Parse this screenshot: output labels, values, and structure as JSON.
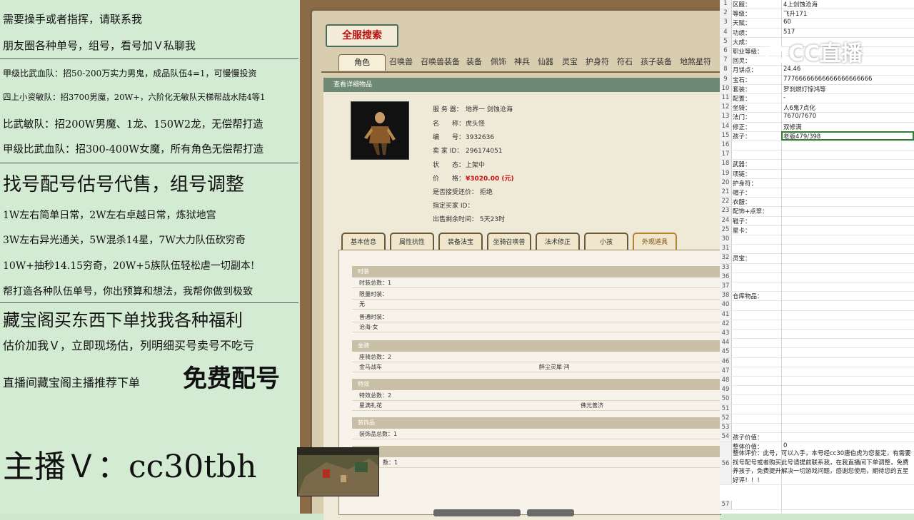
{
  "left_panel": {
    "lines": [
      "需要操手或者指挥，请联系我",
      "朋友圈各种单号，组号，看号加Ｖ私聊我",
      "甲级比武血队：招50-200万实力男鬼，成品队伍4=1，可慢慢投资",
      "四上小资敏队：招3700男魔，20W+，六阶化无敏队天梯帮战水陆4等1",
      "比武敏队：招200W男魔、1龙、150W2龙，无偿帮打造",
      "甲级比武血队：招300-400W女魔，所有角色无偿帮打造",
      "找号配号估号代售，组号调整",
      "1W左右简单日常，2W左右卓越日常，炼狱地宫",
      "3W左右异光通关，5W混杀14星，7W大力队伍砍穷奇",
      "10W+抽秒14.15穷奇，20W+5族队伍轻松虐一切副本!",
      "帮打造各种队伍单号，你出预算和想法，我帮你做到极致",
      "藏宝阁买东西下单找我各种福利",
      "估价加我Ｖ，立即现场估，列明细买号卖号不吃亏",
      "直播间藏宝阁主播推荐下单",
      "免费配号",
      "主播Ｖ：cc30tbh"
    ]
  },
  "game": {
    "banner": "全服搜索",
    "tabs": [
      "角色",
      "召唤兽",
      "召唤兽装备",
      "装备",
      "佩饰",
      "神兵",
      "仙器",
      "灵宝",
      "护身符",
      "符石",
      "孩子装备",
      "地煞星符"
    ],
    "section_title": "查看详细物品",
    "info": [
      {
        "label": "服 务 器：",
        "value": "地界一 剑蚀沧海"
      },
      {
        "label": "名　　称：",
        "value": "虎头怪"
      },
      {
        "label": "编　　号：",
        "value": "3932636"
      },
      {
        "label": "卖 家 ID：",
        "value": "296174051"
      },
      {
        "label": "状　　态：",
        "value": "上架中"
      },
      {
        "label": "价　　格：",
        "value": "¥3020.00 (元)"
      },
      {
        "label": "是否接受还价：",
        "value": "拒绝"
      },
      {
        "label": "指定买家 ID：",
        "value": ""
      },
      {
        "label": "出售剩余时间：",
        "value": "5天23时"
      }
    ],
    "subtabs": [
      "基本信息",
      "属性抗性",
      "装备法宝",
      "坐骑召唤兽",
      "法术修正",
      "小孩",
      "外观道具"
    ],
    "sections": [
      {
        "title": "时装",
        "rows": [
          "时装总数：1",
          "限量时装：",
          "无",
          "普通时装：",
          "沧海·女"
        ]
      },
      {
        "title": "坐骑",
        "rows": [
          "座骑总数：2",
          "金马战车"
        ],
        "extra": "醉尘灵犀·鸿"
      },
      {
        "title": "特效",
        "rows": [
          "特效总数：2",
          "星满礼花"
        ],
        "extra": "佛光普济"
      },
      {
        "title": "装饰品",
        "rows": [
          "装饰品总数：1"
        ]
      },
      {
        "title": "",
        "rows": [
          "数：1"
        ]
      }
    ]
  },
  "sheet": {
    "logo": "CC直播",
    "rows": [
      {
        "n": "1",
        "k": "区服：",
        "v": "4上剑蚀沧海"
      },
      {
        "n": "2",
        "k": "等级：",
        "v": "飞升171"
      },
      {
        "n": "3",
        "k": "天赋：",
        "v": "60"
      },
      {
        "n": "4",
        "k": "功绩：",
        "v": "517"
      },
      {
        "n": "5",
        "k": "大成：",
        "v": ""
      },
      {
        "n": "6",
        "k": "职业等级：",
        "v": ""
      },
      {
        "n": "7",
        "k": "回灵：",
        "v": ""
      },
      {
        "n": "8",
        "k": "月饼点：",
        "v": "24.46"
      },
      {
        "n": "9",
        "k": "宝石：",
        "v": "77766666666666666666666"
      },
      {
        "n": "10",
        "k": "套装：",
        "v": "罗刹燃灯惊鸿等"
      },
      {
        "n": "11",
        "k": "配置：",
        "v": "-"
      },
      {
        "n": "12",
        "k": "坐骑：",
        "v": "人6鬼7点化"
      },
      {
        "n": "13",
        "k": "法门：",
        "v": "7670/7670"
      },
      {
        "n": "14",
        "k": "修正：",
        "v": "双修满"
      },
      {
        "n": "15",
        "k": "孩子：",
        "v": "老版479/398"
      },
      {
        "n": "16",
        "k": "",
        "v": ""
      },
      {
        "n": "17",
        "k": "",
        "v": ""
      },
      {
        "n": "18",
        "k": "武器：",
        "v": ""
      },
      {
        "n": "19",
        "k": "项链：",
        "v": ""
      },
      {
        "n": "20",
        "k": "护身符：",
        "v": ""
      },
      {
        "n": "21",
        "k": "帽子：",
        "v": ""
      },
      {
        "n": "22",
        "k": "衣服：",
        "v": ""
      },
      {
        "n": "23",
        "k": "配饰+点翠：",
        "v": ""
      },
      {
        "n": "24",
        "k": "鞋子：",
        "v": ""
      },
      {
        "n": "25",
        "k": "星卡：",
        "v": ""
      },
      {
        "n": "30",
        "k": "",
        "v": ""
      },
      {
        "n": "31",
        "k": "",
        "v": ""
      },
      {
        "n": "32",
        "k": "灵宝：",
        "v": ""
      },
      {
        "n": "33",
        "k": "",
        "v": ""
      },
      {
        "n": "36",
        "k": "",
        "v": ""
      },
      {
        "n": "37",
        "k": "",
        "v": ""
      },
      {
        "n": "38",
        "k": "仓库物品：",
        "v": ""
      },
      {
        "n": "40",
        "k": "",
        "v": ""
      },
      {
        "n": "41",
        "k": "",
        "v": ""
      },
      {
        "n": "42",
        "k": "",
        "v": ""
      },
      {
        "n": "43",
        "k": "",
        "v": ""
      },
      {
        "n": "44",
        "k": "",
        "v": ""
      },
      {
        "n": "45",
        "k": "",
        "v": ""
      },
      {
        "n": "46",
        "k": "",
        "v": ""
      },
      {
        "n": "47",
        "k": "",
        "v": ""
      },
      {
        "n": "48",
        "k": "",
        "v": ""
      },
      {
        "n": "49",
        "k": "",
        "v": ""
      },
      {
        "n": "50",
        "k": "",
        "v": ""
      },
      {
        "n": "51",
        "k": "",
        "v": ""
      },
      {
        "n": "52",
        "k": "",
        "v": ""
      },
      {
        "n": "53",
        "k": "",
        "v": ""
      },
      {
        "n": "54",
        "k": "孩子价值：",
        "v": ""
      },
      {
        "n": "55",
        "k": "整体价值：",
        "v": "0"
      }
    ],
    "row56": "56",
    "row57": "57",
    "review": "整体评价：此号，可以入手，本号经cc30唐伯虎为您鉴定，有需要找号配号或者购买此号请提前联系我，在我直播间下单调整，免费养孩子，免费提升解决一切游戏问题，感谢您使用，期待您的五星好评！！！"
  }
}
